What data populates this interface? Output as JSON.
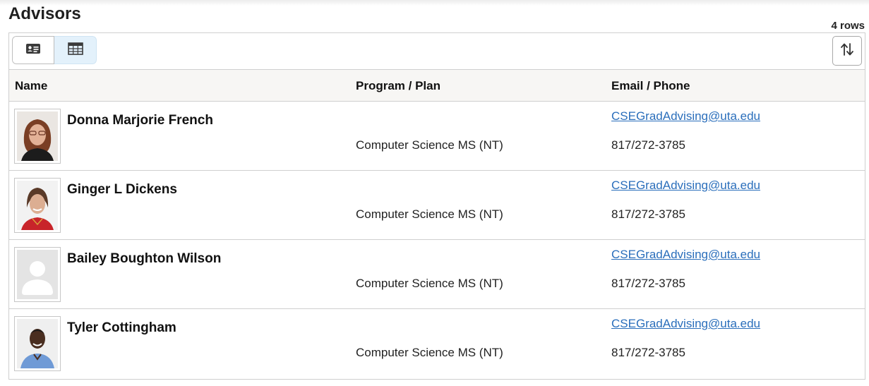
{
  "page": {
    "title": "Advisors",
    "row_count": "4 rows"
  },
  "toolbar": {
    "card_view_icon": "contact-card-icon",
    "grid_view_icon": "grid-view-icon",
    "sort_icon": "sort-arrows-icon"
  },
  "columns": {
    "name": "Name",
    "program": "Program / Plan",
    "contact": "Email / Phone"
  },
  "advisors": [
    {
      "name": "Donna Marjorie French",
      "program": "Computer Science MS (NT)",
      "email": "CSEGradAdvising@uta.edu",
      "phone": "817/272-3785"
    },
    {
      "name": "Ginger L Dickens",
      "program": "Computer Science MS (NT)",
      "email": "CSEGradAdvising@uta.edu",
      "phone": "817/272-3785"
    },
    {
      "name": "Bailey Boughton Wilson",
      "program": "Computer Science MS (NT)",
      "email": "CSEGradAdvising@uta.edu",
      "phone": "817/272-3785"
    },
    {
      "name": "Tyler Cottingham",
      "program": "Computer Science MS (NT)",
      "email": "CSEGradAdvising@uta.edu",
      "phone": "817/272-3785"
    }
  ],
  "colors": {
    "link": "#2a6ebb",
    "header_bg": "#f7f6f4",
    "active_toggle_bg": "#e3f1fb",
    "border": "#cfcfcf"
  }
}
